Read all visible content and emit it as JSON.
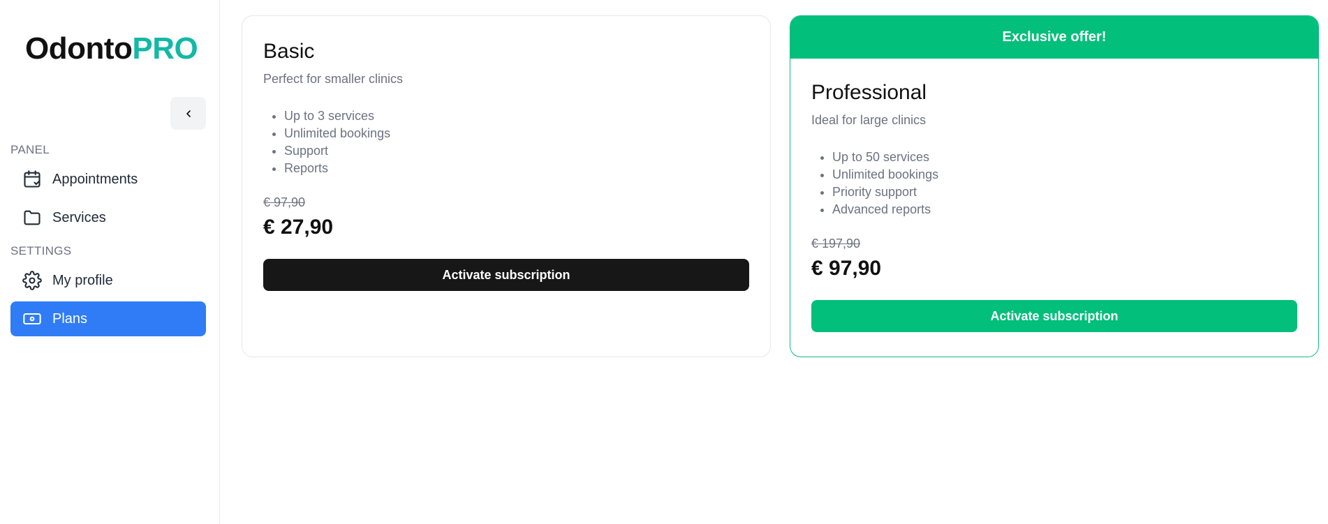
{
  "sidebar": {
    "logo": {
      "part1": "Odonto",
      "part2": "PRO"
    },
    "sections": [
      {
        "title": "PANEL",
        "items": [
          {
            "label": "Appointments",
            "icon": "calendar-check-icon"
          },
          {
            "label": "Services",
            "icon": "folder-icon"
          }
        ]
      },
      {
        "title": "SETTINGS",
        "items": [
          {
            "label": "My profile",
            "icon": "gear-icon"
          },
          {
            "label": "Plans",
            "icon": "banknote-icon",
            "active": true
          }
        ]
      }
    ]
  },
  "plans": [
    {
      "name": "Basic",
      "description": "Perfect for smaller clinics",
      "features": [
        "Up to 3 services",
        "Unlimited bookings",
        "Support",
        "Reports"
      ],
      "old_price": "€ 97,90",
      "price": "€ 27,90",
      "button": "Activate subscription"
    },
    {
      "badge": "Exclusive offer!",
      "name": "Professional",
      "description": "Ideal for large clinics",
      "features": [
        "Up to 50 services",
        "Unlimited bookings",
        "Priority support",
        "Advanced reports"
      ],
      "old_price": "€ 197,90",
      "price": "€ 97,90",
      "button": "Activate subscription"
    }
  ],
  "colors": {
    "accent_green": "#02bf7b",
    "active_blue": "#2f7cf6",
    "logo_teal": "#14b8a6",
    "dark_button": "#171717"
  }
}
